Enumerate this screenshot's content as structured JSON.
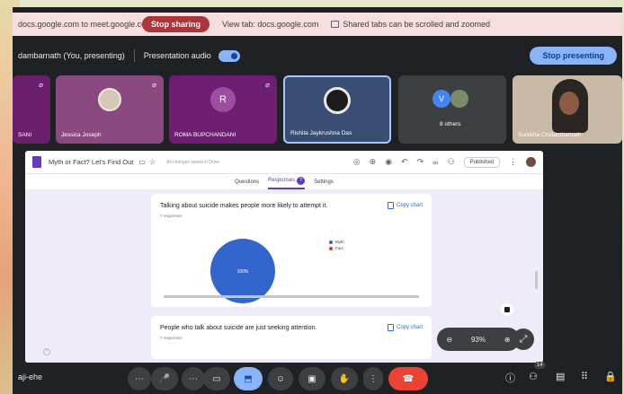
{
  "share_bar": {
    "url_text": "docs.google.com to meet.google.com",
    "stop_sharing": "Stop sharing",
    "view_tab": "View tab: docs.google.com",
    "shared_tabs_note": "Shared tabs can be scrolled and zoomed"
  },
  "present_bar": {
    "presenter": "dambarnath (You, presenting)",
    "audio_label": "Presentation audio",
    "audio_on": true,
    "stop_presenting": "Stop presenting"
  },
  "participants": [
    {
      "label": "SANI"
    },
    {
      "label": "Jessica Joseph"
    },
    {
      "label": "ROMA BUPCHANDANI",
      "initial": "R"
    },
    {
      "label": "Rishita Jaykrushna Das"
    },
    {
      "label": "8 others",
      "initial": "V"
    },
    {
      "label": "Surekha Chidambarnath"
    }
  ],
  "doc": {
    "title": "Myth or Fact? Let's Find Out",
    "saved_note": "All changes saved in Drive",
    "published": "Published",
    "tabs": [
      "Questions",
      "Responses",
      "Settings"
    ],
    "response_count": "?",
    "q1": {
      "text": "Talking about suicide makes people more likely to attempt it.",
      "responses": "? responses",
      "copy": "Copy chart",
      "pie_label": "100%",
      "legend": [
        {
          "name": "Myth",
          "color": "#3366cc"
        },
        {
          "name": "Fact",
          "color": "#dc3912"
        }
      ]
    },
    "q2": {
      "text": "People who talk about suicide are just seeking attention.",
      "responses": "? responses",
      "copy": "Copy chart"
    }
  },
  "zoom": {
    "level": "93%"
  },
  "toolbar": {
    "meeting_code": "aji-ehe",
    "people_count": "14"
  }
}
